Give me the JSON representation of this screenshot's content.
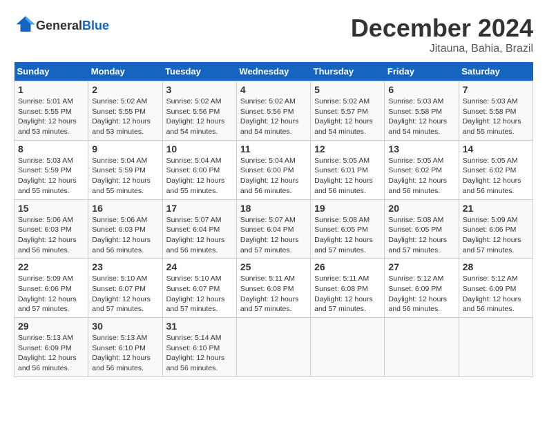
{
  "header": {
    "logo_general": "General",
    "logo_blue": "Blue",
    "month_title": "December 2024",
    "location": "Jitauna, Bahia, Brazil"
  },
  "weekdays": [
    "Sunday",
    "Monday",
    "Tuesday",
    "Wednesday",
    "Thursday",
    "Friday",
    "Saturday"
  ],
  "weeks": [
    [
      {
        "day": "1",
        "sunrise": "5:01 AM",
        "sunset": "5:55 PM",
        "daylight": "12 hours and 53 minutes."
      },
      {
        "day": "2",
        "sunrise": "5:02 AM",
        "sunset": "5:55 PM",
        "daylight": "12 hours and 53 minutes."
      },
      {
        "day": "3",
        "sunrise": "5:02 AM",
        "sunset": "5:56 PM",
        "daylight": "12 hours and 54 minutes."
      },
      {
        "day": "4",
        "sunrise": "5:02 AM",
        "sunset": "5:56 PM",
        "daylight": "12 hours and 54 minutes."
      },
      {
        "day": "5",
        "sunrise": "5:02 AM",
        "sunset": "5:57 PM",
        "daylight": "12 hours and 54 minutes."
      },
      {
        "day": "6",
        "sunrise": "5:03 AM",
        "sunset": "5:58 PM",
        "daylight": "12 hours and 54 minutes."
      },
      {
        "day": "7",
        "sunrise": "5:03 AM",
        "sunset": "5:58 PM",
        "daylight": "12 hours and 55 minutes."
      }
    ],
    [
      {
        "day": "8",
        "sunrise": "5:03 AM",
        "sunset": "5:59 PM",
        "daylight": "12 hours and 55 minutes."
      },
      {
        "day": "9",
        "sunrise": "5:04 AM",
        "sunset": "5:59 PM",
        "daylight": "12 hours and 55 minutes."
      },
      {
        "day": "10",
        "sunrise": "5:04 AM",
        "sunset": "6:00 PM",
        "daylight": "12 hours and 55 minutes."
      },
      {
        "day": "11",
        "sunrise": "5:04 AM",
        "sunset": "6:00 PM",
        "daylight": "12 hours and 56 minutes."
      },
      {
        "day": "12",
        "sunrise": "5:05 AM",
        "sunset": "6:01 PM",
        "daylight": "12 hours and 56 minutes."
      },
      {
        "day": "13",
        "sunrise": "5:05 AM",
        "sunset": "6:02 PM",
        "daylight": "12 hours and 56 minutes."
      },
      {
        "day": "14",
        "sunrise": "5:05 AM",
        "sunset": "6:02 PM",
        "daylight": "12 hours and 56 minutes."
      }
    ],
    [
      {
        "day": "15",
        "sunrise": "5:06 AM",
        "sunset": "6:03 PM",
        "daylight": "12 hours and 56 minutes."
      },
      {
        "day": "16",
        "sunrise": "5:06 AM",
        "sunset": "6:03 PM",
        "daylight": "12 hours and 56 minutes."
      },
      {
        "day": "17",
        "sunrise": "5:07 AM",
        "sunset": "6:04 PM",
        "daylight": "12 hours and 56 minutes."
      },
      {
        "day": "18",
        "sunrise": "5:07 AM",
        "sunset": "6:04 PM",
        "daylight": "12 hours and 57 minutes."
      },
      {
        "day": "19",
        "sunrise": "5:08 AM",
        "sunset": "6:05 PM",
        "daylight": "12 hours and 57 minutes."
      },
      {
        "day": "20",
        "sunrise": "5:08 AM",
        "sunset": "6:05 PM",
        "daylight": "12 hours and 57 minutes."
      },
      {
        "day": "21",
        "sunrise": "5:09 AM",
        "sunset": "6:06 PM",
        "daylight": "12 hours and 57 minutes."
      }
    ],
    [
      {
        "day": "22",
        "sunrise": "5:09 AM",
        "sunset": "6:06 PM",
        "daylight": "12 hours and 57 minutes."
      },
      {
        "day": "23",
        "sunrise": "5:10 AM",
        "sunset": "6:07 PM",
        "daylight": "12 hours and 57 minutes."
      },
      {
        "day": "24",
        "sunrise": "5:10 AM",
        "sunset": "6:07 PM",
        "daylight": "12 hours and 57 minutes."
      },
      {
        "day": "25",
        "sunrise": "5:11 AM",
        "sunset": "6:08 PM",
        "daylight": "12 hours and 57 minutes."
      },
      {
        "day": "26",
        "sunrise": "5:11 AM",
        "sunset": "6:08 PM",
        "daylight": "12 hours and 57 minutes."
      },
      {
        "day": "27",
        "sunrise": "5:12 AM",
        "sunset": "6:09 PM",
        "daylight": "12 hours and 56 minutes."
      },
      {
        "day": "28",
        "sunrise": "5:12 AM",
        "sunset": "6:09 PM",
        "daylight": "12 hours and 56 minutes."
      }
    ],
    [
      {
        "day": "29",
        "sunrise": "5:13 AM",
        "sunset": "6:09 PM",
        "daylight": "12 hours and 56 minutes."
      },
      {
        "day": "30",
        "sunrise": "5:13 AM",
        "sunset": "6:10 PM",
        "daylight": "12 hours and 56 minutes."
      },
      {
        "day": "31",
        "sunrise": "5:14 AM",
        "sunset": "6:10 PM",
        "daylight": "12 hours and 56 minutes."
      },
      null,
      null,
      null,
      null
    ]
  ]
}
